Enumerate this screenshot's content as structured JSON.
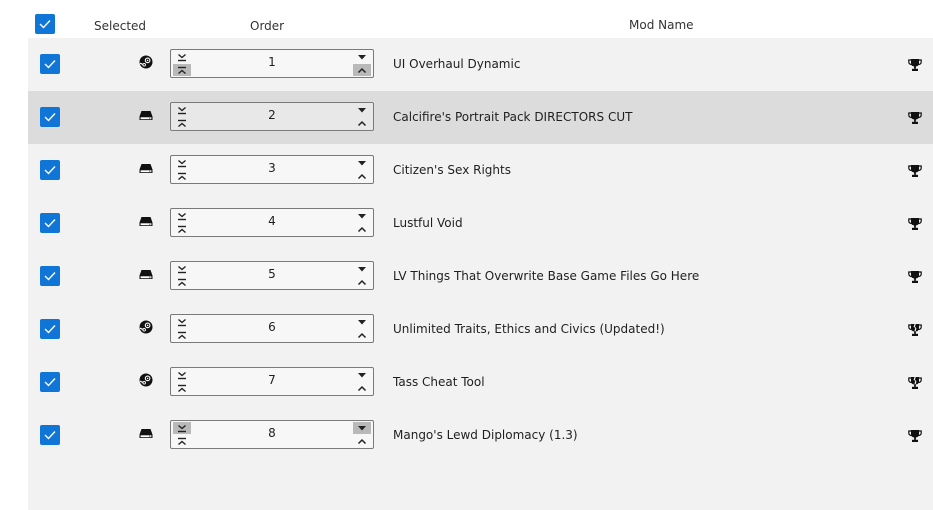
{
  "header": {
    "selected_label": "Selected",
    "order_label": "Order",
    "mod_name_label": "Mod Name",
    "select_all_checked": true
  },
  "colors": {
    "accent": "#0f75d6",
    "row_bg": "#f2f2f2",
    "row_highlight": "#dcdcdc"
  },
  "rows": [
    {
      "checked": true,
      "source": "steam-icon",
      "order": "1",
      "name": "UI Overhaul Dynamic",
      "trophy": "trophy-icon",
      "highlight": false
    },
    {
      "checked": true,
      "source": "local-drive-icon",
      "order": "2",
      "name": "Calcifire's Portrait Pack DIRECTORS CUT",
      "trophy": "trophy-icon",
      "highlight": true
    },
    {
      "checked": true,
      "source": "local-drive-icon",
      "order": "3",
      "name": "Citizen's Sex Rights",
      "trophy": "trophy-icon",
      "highlight": false
    },
    {
      "checked": true,
      "source": "local-drive-icon",
      "order": "4",
      "name": "Lustful Void",
      "trophy": "trophy-icon",
      "highlight": false
    },
    {
      "checked": true,
      "source": "local-drive-icon",
      "order": "5",
      "name": "LV Things That Overwrite Base Game Files Go Here",
      "trophy": "trophy-icon",
      "highlight": false
    },
    {
      "checked": true,
      "source": "steam-icon",
      "order": "6",
      "name": "Unlimited Traits, Ethics and Civics (Updated!)",
      "trophy": "trophy-broken-icon",
      "highlight": false
    },
    {
      "checked": true,
      "source": "steam-icon",
      "order": "7",
      "name": "Tass Cheat Tool",
      "trophy": "trophy-broken-icon",
      "highlight": false
    },
    {
      "checked": true,
      "source": "local-drive-icon",
      "order": "8",
      "name": "Mango's Lewd Diplomacy (1.3)",
      "trophy": "trophy-icon",
      "highlight": false
    }
  ]
}
